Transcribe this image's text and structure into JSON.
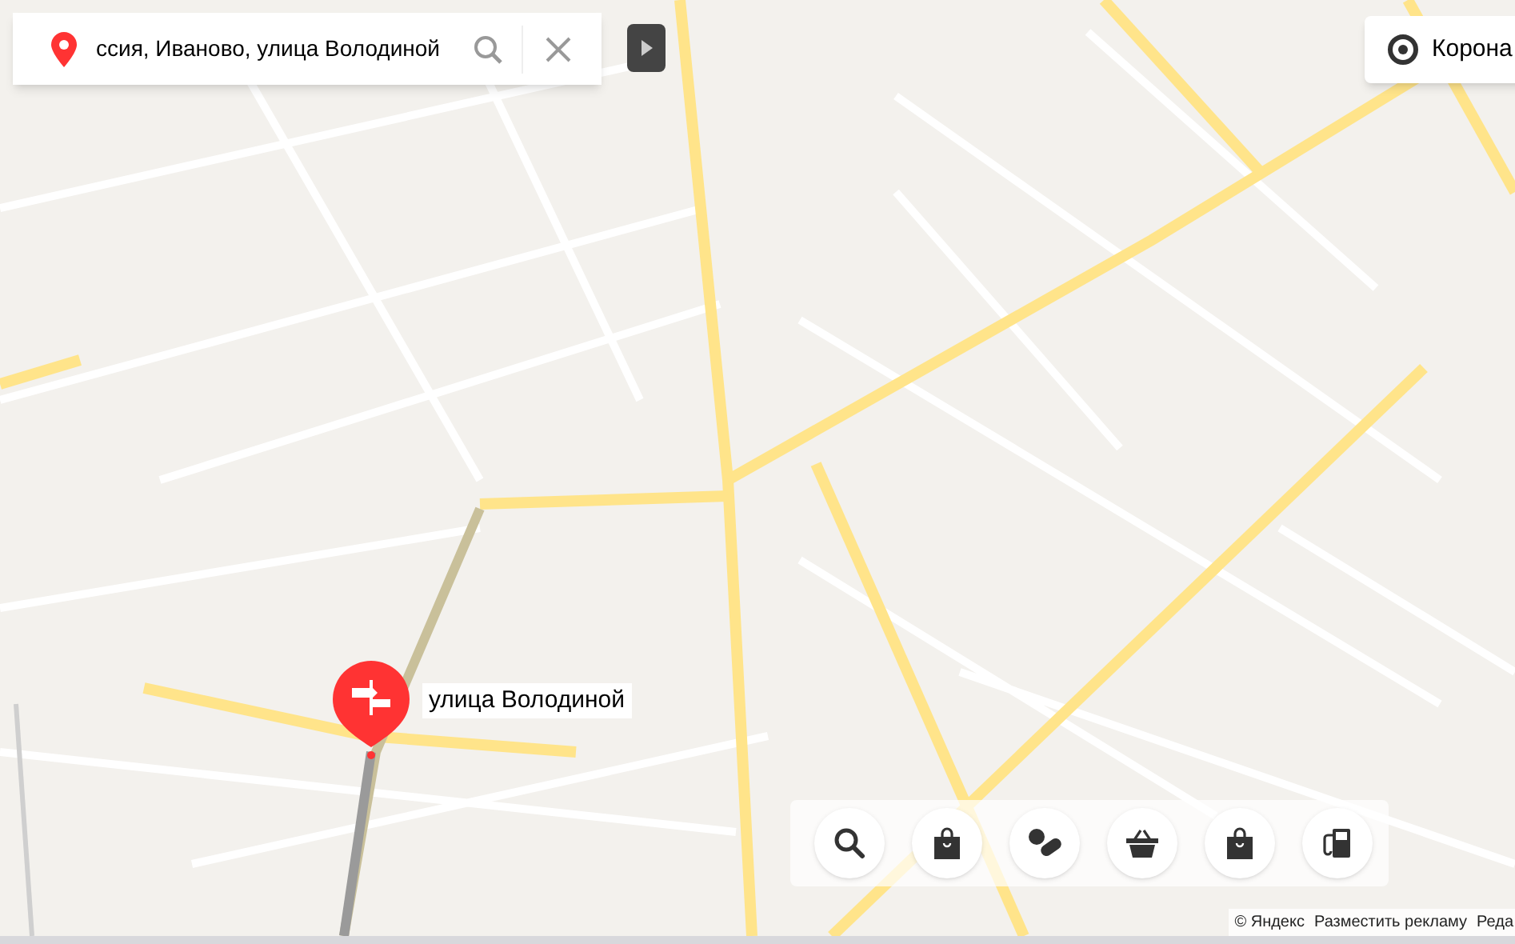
{
  "search": {
    "value": "ссия, Иваново, улица Володиной"
  },
  "layers_button": {
    "label": "Корона"
  },
  "pin": {
    "label": "улица Володиной"
  },
  "toolbar": [
    {
      "kind": "search"
    },
    {
      "kind": "bag"
    },
    {
      "kind": "pills"
    },
    {
      "kind": "basket"
    },
    {
      "kind": "bag"
    },
    {
      "kind": "fuel"
    }
  ],
  "footer": [
    "© Яндекс",
    "Разместить рекламу",
    "Реда"
  ]
}
